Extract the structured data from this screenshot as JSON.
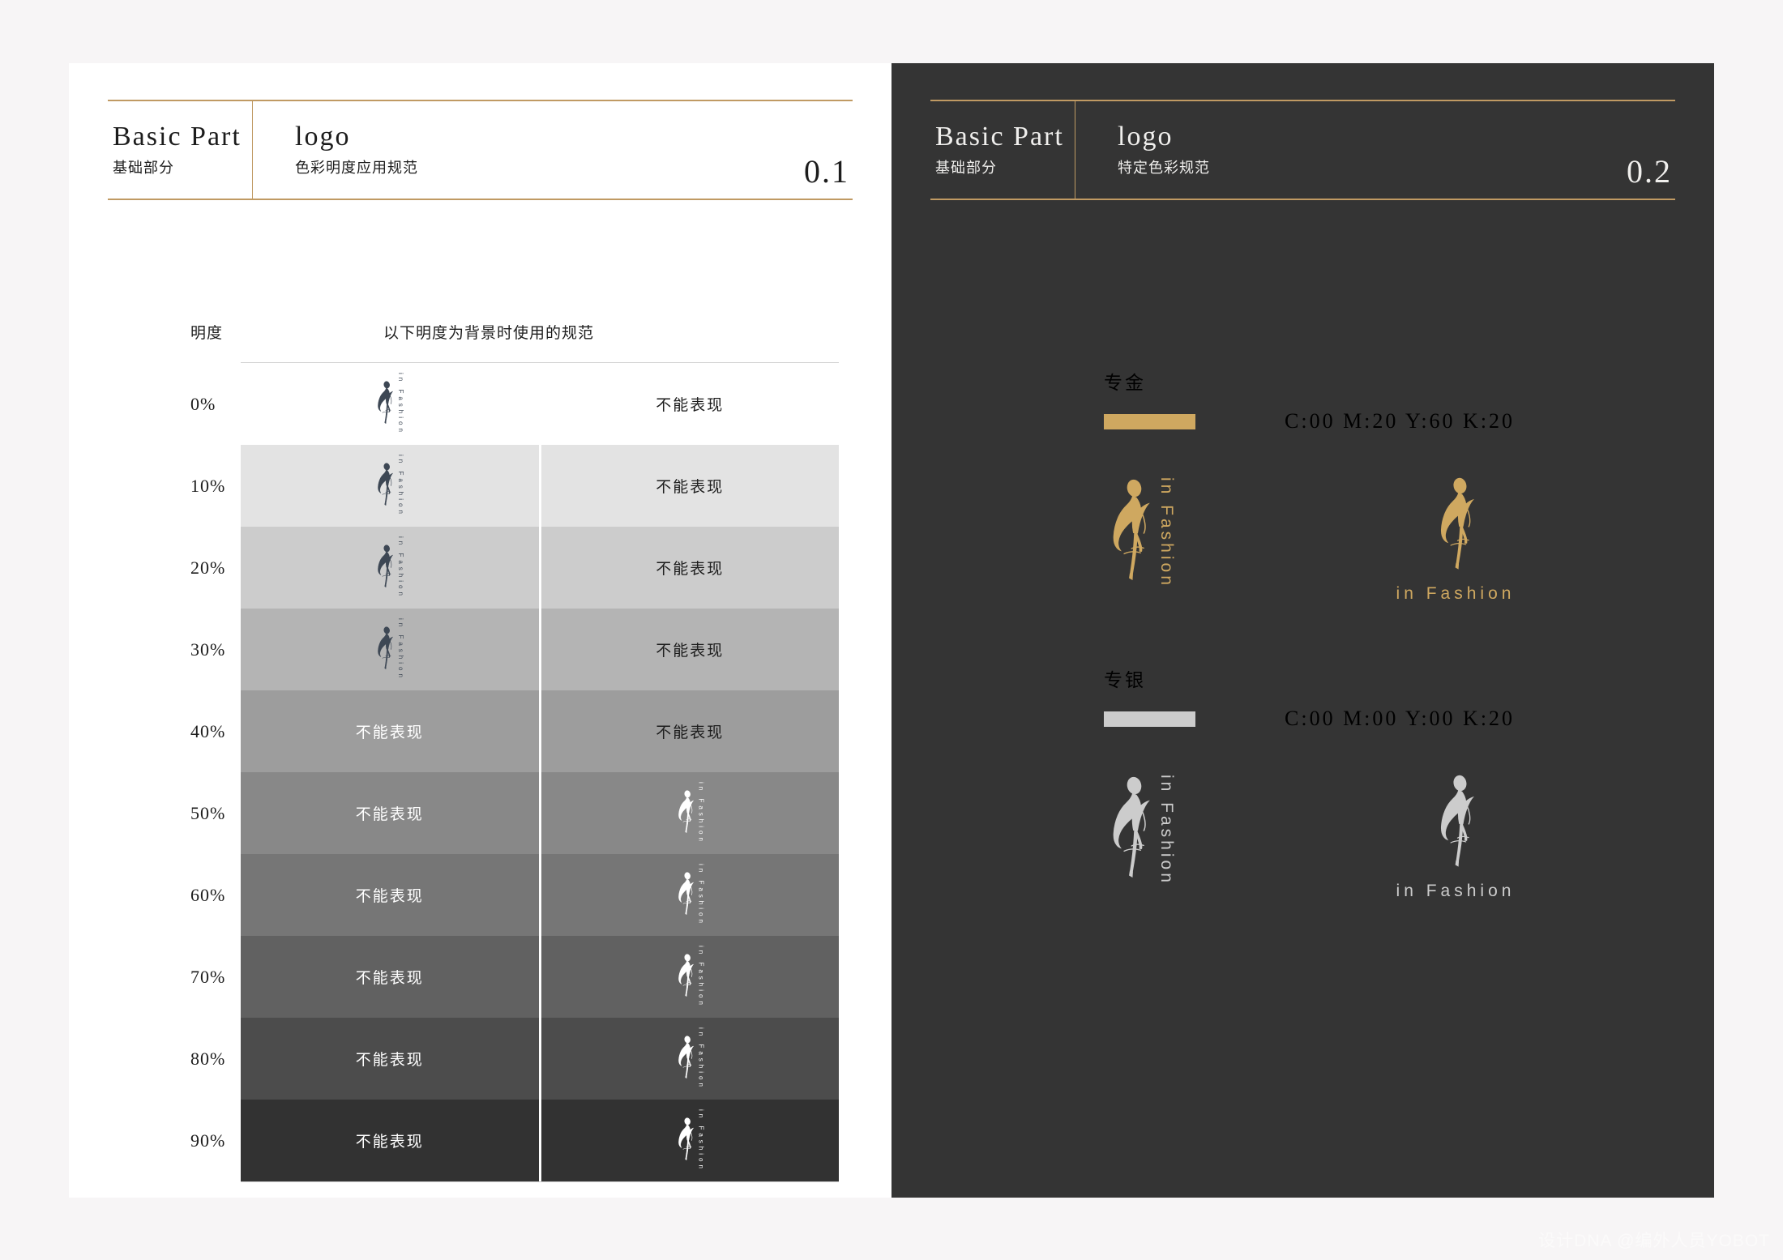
{
  "watermark": "设计DNA @编外人员YOBOT",
  "theme": {
    "gold_rule": "#c09a63",
    "dark_page_bg": "#343434",
    "light_page_bg": "#ffffff",
    "canvas_bg": "#f7f5f6",
    "gold_spot": "#cfa860",
    "silver_spot": "#cccccc",
    "logo_dark": "#3d4754"
  },
  "left_page": {
    "header": {
      "section_en": "Basic Part",
      "section_cn": "基础部分",
      "topic_en": "logo",
      "topic_cn": "色彩明度应用规范",
      "page_no": "0.1"
    },
    "table": {
      "col_brightness_header": "明度",
      "col_usage_header": "以下明度为背景时使用的规范",
      "not_allowed_label": "不能表现",
      "wordmark": "in Fashion",
      "rows": [
        {
          "label": "0%",
          "bg": "#ffffff",
          "left": "logo-dark",
          "right": "text-dark",
          "row_divider": false
        },
        {
          "label": "10%",
          "bg": "#e3e3e3",
          "left": "logo-dark",
          "right": "text-dark",
          "row_divider": true
        },
        {
          "label": "20%",
          "bg": "#cccccc",
          "left": "logo-dark",
          "right": "text-dark",
          "row_divider": true
        },
        {
          "label": "30%",
          "bg": "#b4b4b4",
          "left": "logo-dark",
          "right": "text-dark",
          "row_divider": true
        },
        {
          "label": "40%",
          "bg": "#9d9d9d",
          "left": "text-white",
          "right": "text-dark",
          "row_divider": true
        },
        {
          "label": "50%",
          "bg": "#888888",
          "left": "text-white",
          "right": "logo-white",
          "row_divider": true
        },
        {
          "label": "60%",
          "bg": "#767676",
          "left": "text-white",
          "right": "logo-white",
          "row_divider": true
        },
        {
          "label": "70%",
          "bg": "#616161",
          "left": "text-white",
          "right": "logo-white",
          "row_divider": true
        },
        {
          "label": "80%",
          "bg": "#4c4c4c",
          "left": "text-white",
          "right": "logo-white",
          "row_divider": true
        },
        {
          "label": "90%",
          "bg": "#323232",
          "left": "text-white",
          "right": "logo-white",
          "row_divider": true
        }
      ]
    }
  },
  "right_page": {
    "header": {
      "section_en": "Basic Part",
      "section_cn": "基础部分",
      "topic_en": "logo",
      "topic_cn": "特定色彩规范",
      "page_no": "0.2"
    },
    "specs": [
      {
        "name": "专金",
        "swatch_hex": "#cfa860",
        "cmyk": "C:00  M:20  Y:60  K:20",
        "wordmark": "in Fashion"
      },
      {
        "name": "专银",
        "swatch_hex": "#cccccc",
        "cmyk": "C:00  M:00  Y:00  K:20",
        "wordmark": "in Fashion"
      }
    ]
  }
}
